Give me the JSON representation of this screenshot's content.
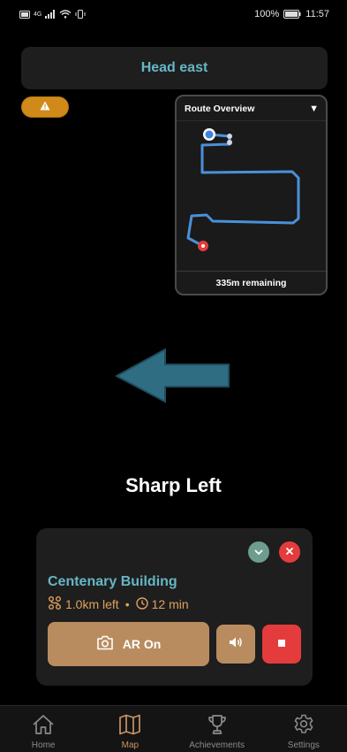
{
  "status_bar": {
    "left_indicators": "4G",
    "battery": "100%",
    "time": "11:57"
  },
  "instruction": {
    "text": "Head east"
  },
  "warning": {
    "icon": "warning-icon"
  },
  "route_overview": {
    "title": "Route Overview",
    "toggle": "▼",
    "remaining": "335m remaining"
  },
  "maneuver": {
    "label": "Sharp Left",
    "arrow_color": "#2f6e82"
  },
  "destination": {
    "name": "Centenary Building",
    "distance": "1.0km left",
    "separator": "•",
    "duration": "12 min",
    "ar_label": "AR On"
  },
  "nav": {
    "items": [
      {
        "label": "Home",
        "icon": "home-icon"
      },
      {
        "label": "Map",
        "icon": "map-icon"
      },
      {
        "label": "Achievements",
        "icon": "trophy-icon"
      },
      {
        "label": "Settings",
        "icon": "gear-icon"
      }
    ],
    "active": "Map"
  },
  "colors": {
    "accent_teal": "#67b6c6",
    "accent_tan": "#b98c60",
    "danger": "#e43c3c",
    "warning": "#d08a1a",
    "route_line": "#4a90d9"
  }
}
